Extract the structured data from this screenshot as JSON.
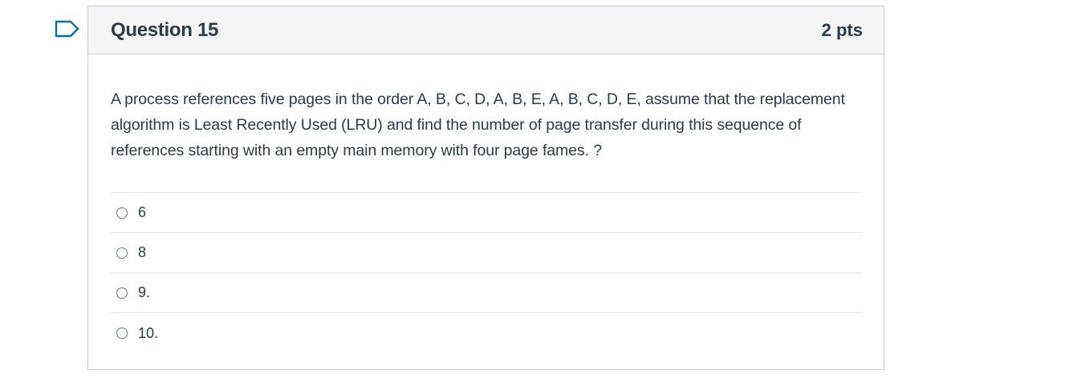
{
  "question": {
    "title": "Question 15",
    "points": "2 pts",
    "text": "A process references five pages in the order A, B, C, D, A, B, E, A, B, C, D, E, assume that the replacement algorithm is Least Recently Used (LRU) and find the number of page transfer during this sequence of references starting with an empty main memory with four page fames. ?",
    "answers": [
      {
        "label": "6"
      },
      {
        "label": "8"
      },
      {
        "label": "9."
      },
      {
        "label": "10."
      }
    ]
  },
  "colors": {
    "flag_border": "#0770a3",
    "header_bg": "#f5f5f5",
    "border": "#c7cdd1",
    "text": "#2d3b45"
  },
  "icons": {
    "flag": "flag-outline-icon",
    "radio": "radio-unchecked-icon"
  }
}
